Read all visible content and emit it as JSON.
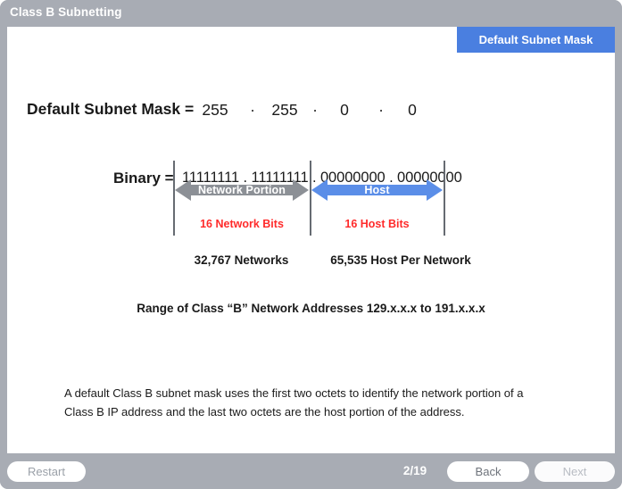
{
  "window": {
    "title": "Class B Subnetting"
  },
  "topic_tab": {
    "label": "Default Subnet Mask"
  },
  "slide": {
    "mask": {
      "label": "Default Subnet Mask =",
      "octets": [
        "255",
        "255",
        "0",
        "0"
      ],
      "separator": "·"
    },
    "binary": {
      "label": "Binary =",
      "value": "11111111 . 11111111 . 00000000 . 00000000"
    },
    "arrows": {
      "network_label": "Network Portion",
      "host_label": "Host",
      "network_color": "#8c9096",
      "host_color": "#5b8ee8"
    },
    "bits": {
      "network": "16 Network Bits",
      "host": "16 Host Bits",
      "color": "#ff2b2b"
    },
    "counts": {
      "networks": "32,767 Networks",
      "hosts": "65,535 Host Per Network"
    },
    "range_line": "Range of Class “B” Network Addresses 129.x.x.x to 191.x.x.x",
    "description": "A default Class B subnet mask uses the first two octets to identify the network portion of a Class B IP address and the last two octets are the host portion of the address."
  },
  "toolbar": {
    "restart_label": "Restart",
    "page_indicator": "2/19",
    "back_label": "Back",
    "next_label": "Next"
  }
}
